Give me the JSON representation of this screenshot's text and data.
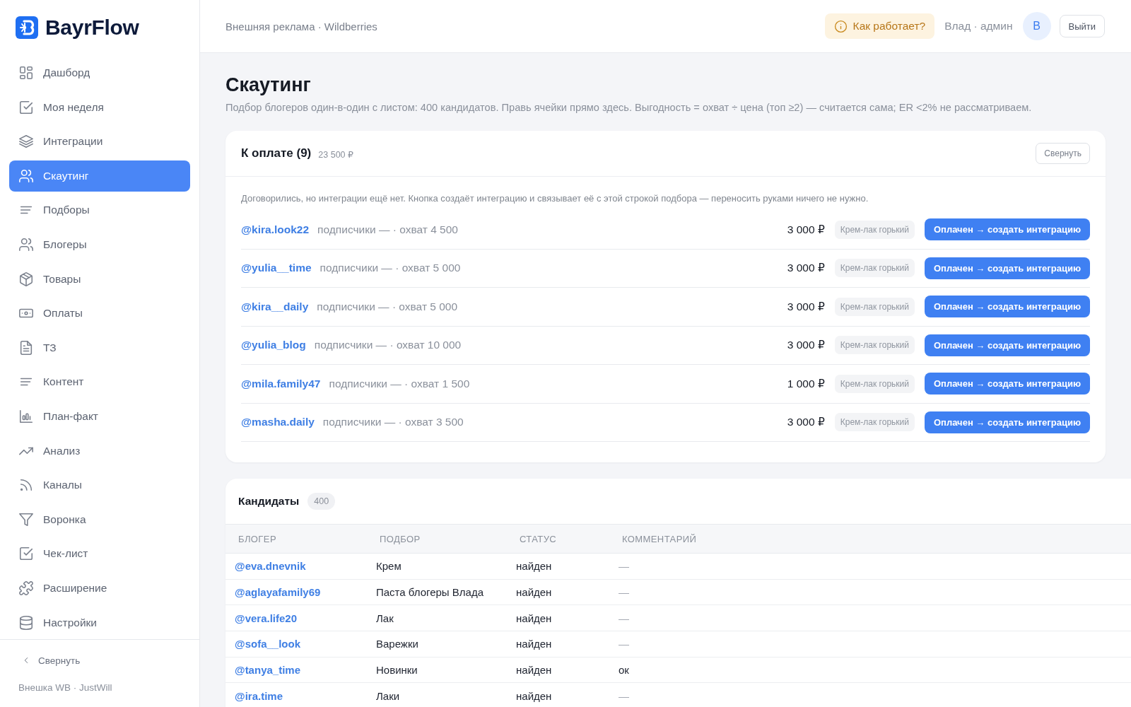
{
  "sidebar": {
    "logo": "BayrFlow",
    "items": [
      {
        "label": "Дашборд",
        "selected": false
      },
      {
        "label": "Моя неделя",
        "selected": false
      },
      {
        "label": "Интеграции",
        "selected": false
      },
      {
        "label": "Скаутинг",
        "selected": true
      },
      {
        "label": "Подборы",
        "selected": false
      },
      {
        "label": "Блогеры",
        "selected": false
      },
      {
        "label": "Товары",
        "selected": false
      },
      {
        "label": "Оплаты",
        "selected": false
      },
      {
        "label": "ТЗ",
        "selected": false
      },
      {
        "label": "Контент",
        "selected": false
      },
      {
        "label": "План-факт",
        "selected": false
      },
      {
        "label": "Анализ",
        "selected": false
      },
      {
        "label": "Каналы",
        "selected": false
      },
      {
        "label": "Воронка",
        "selected": false
      },
      {
        "label": "Чек-лист",
        "selected": false
      },
      {
        "label": "Расширение",
        "selected": false
      },
      {
        "label": "Настройки",
        "selected": false
      }
    ],
    "collapse_button": "Свернуть",
    "footer": "Внешка WB · JustWill"
  },
  "header": {
    "breadcrumb": "Внешняя реклама · Wildberries",
    "help_button": "Как работает?",
    "user": "Влад · админ",
    "avatar": "В",
    "logout_button": "Выйти"
  },
  "page": {
    "title": "Скаутинг",
    "subtitle": "Подбор блогеров один-в-один с листом: 400 кандидатов. Правь ячейки прямо здесь. Выгодность = охват ÷ цена (топ ≥2) — считается сама; ER <2% не рассматриваем."
  },
  "payment_card": {
    "title": "К оплате (9)",
    "total": "23 500 ₽",
    "collapse_button": "Свернуть",
    "note": "Договорились, но интеграции ещё нет. Кнопка создаёт интеграцию и связывает её с этой строкой подбора — переносить руками ничего не нужно.",
    "rows": [
      {
        "handle": "@kira.look22",
        "stats": "подписчики — · охват 4 500",
        "price": "3 000 ₽",
        "product": "Крем-лак горький",
        "button": "Оплачен → создать интеграцию"
      },
      {
        "handle": "@yulia__time",
        "stats": "подписчики — · охват 5 000",
        "price": "3 000 ₽",
        "product": "Крем-лак горький",
        "button": "Оплачен → создать интеграцию"
      },
      {
        "handle": "@kira__daily",
        "stats": "подписчики — · охват 5 000",
        "price": "3 000 ₽",
        "product": "Крем-лак горький",
        "button": "Оплачен → создать интеграцию"
      },
      {
        "handle": "@yulia_blog",
        "stats": "подписчики — · охват 10 000",
        "price": "3 000 ₽",
        "product": "Крем-лак горький",
        "button": "Оплачен → создать интеграцию"
      },
      {
        "handle": "@mila.family47",
        "stats": "подписчики — · охват 1 500",
        "price": "1 000 ₽",
        "product": "Крем-лак горький",
        "button": "Оплачен → создать интеграцию"
      },
      {
        "handle": "@masha.daily",
        "stats": "подписчики — · охват 3 500",
        "price": "3 000 ₽",
        "product": "Крем-лак горький",
        "button": "Оплачен → создать интеграцию"
      }
    ]
  },
  "candidates": {
    "title": "Кандидаты",
    "count": "400",
    "columns": [
      "БЛОГЕР",
      "ПОДБОР",
      "СТАТУС",
      "КОММЕНТАРИЙ"
    ],
    "rows": [
      {
        "blogger": "@eva.dnevnik",
        "selection": "Крем",
        "status": "найден",
        "comment": "—",
        "comment_empty": true
      },
      {
        "blogger": "@aglayafamily69",
        "selection": "Паста блогеры Влада",
        "status": "найден",
        "comment": "—",
        "comment_empty": true
      },
      {
        "blogger": "@vera.life20",
        "selection": "Лак",
        "status": "найден",
        "comment": "—",
        "comment_empty": true
      },
      {
        "blogger": "@sofa__look",
        "selection": "Варежки",
        "status": "найден",
        "comment": "—",
        "comment_empty": true
      },
      {
        "blogger": "@tanya_time",
        "selection": "Новинки",
        "status": "найден",
        "comment": "ок",
        "comment_empty": false
      },
      {
        "blogger": "@ira.time",
        "selection": "Лаки",
        "status": "найден",
        "comment": "—",
        "comment_empty": true
      }
    ]
  }
}
